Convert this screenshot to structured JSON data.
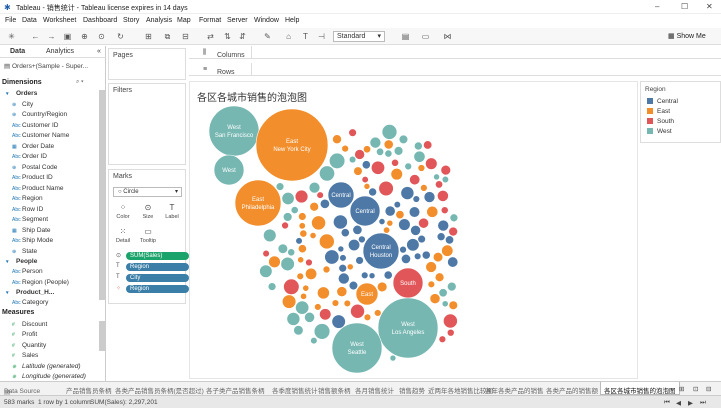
{
  "window": {
    "title": "Tableau - 销售统计 - Tableau license expires in 14 days"
  },
  "menu": [
    "File",
    "Data",
    "Worksheet",
    "Dashboard",
    "Story",
    "Analysis",
    "Map",
    "Format",
    "Server",
    "Window",
    "Help"
  ],
  "toolbar": {
    "fit_mode": "Standard",
    "show_me": "Show Me"
  },
  "data_pane": {
    "tabs": [
      "Data",
      "Analytics"
    ],
    "datasource": "Orders+(Sample - Super...",
    "dimensions_header": "Dimensions",
    "groups": [
      {
        "name": "Orders",
        "fields": [
          "City",
          "Country/Region",
          "Customer ID",
          "Customer Name",
          "Order Date",
          "Order ID",
          "Postal Code",
          "Product ID",
          "Product Name",
          "Region",
          "Row ID",
          "Segment",
          "Ship Date",
          "Ship Mode",
          "State"
        ]
      },
      {
        "name": "People",
        "fields": [
          "Person",
          "Region (People)"
        ]
      },
      {
        "name": "Product_H...",
        "fields": [
          "Category"
        ]
      }
    ],
    "measures_header": "Measures",
    "measures": [
      "Discount",
      "Profit",
      "Quantity",
      "Sales",
      "Latitude (generated)",
      "Longitude (generated)"
    ]
  },
  "cards": {
    "pages": "Pages",
    "filters": "Filters",
    "marks": "Marks",
    "mark_type": "Circle",
    "mark_buttons": [
      "Color",
      "Size",
      "Label",
      "Detail",
      "Tooltip"
    ],
    "pills": [
      "SUM(Sales)",
      "Region",
      "City",
      "Region"
    ]
  },
  "shelves": {
    "columns": "Columns",
    "rows": "Rows"
  },
  "view": {
    "title": "各区各城市销售的泡泡图"
  },
  "legend": {
    "title": "Region",
    "items": [
      {
        "label": "Central",
        "color": "#4e79a7"
      },
      {
        "label": "East",
        "color": "#f28e2b"
      },
      {
        "label": "South",
        "color": "#e15759"
      },
      {
        "label": "West",
        "color": "#76b7b2"
      }
    ]
  },
  "labeled_bubbles": [
    {
      "region": "West",
      "city": "San Francisco"
    },
    {
      "region": "East",
      "city": "New York City"
    },
    {
      "region": "West",
      "city": ""
    },
    {
      "region": "East",
      "city": "Philadelphia"
    },
    {
      "region": "Central",
      "city": ""
    },
    {
      "region": "Central",
      "city": ""
    },
    {
      "region": "Central",
      "city": "Houston"
    },
    {
      "region": "South",
      "city": ""
    },
    {
      "region": "East",
      "city": ""
    },
    {
      "region": "West",
      "city": "Los Angeles"
    },
    {
      "region": "West",
      "city": "Seattle"
    }
  ],
  "sheet_tabs": [
    "Data Source",
    "产品销售员条柄",
    "各类产品销售员条柄(是否超过)",
    "各子类产品销售条柄",
    "各季度销售统计",
    "销售额条柄",
    "各月销售统计",
    "销售趋势",
    "近两年各地销售比较图",
    "各年各类产品的销售",
    "各类产品的销售额",
    "各区各城市销售的泡泡图"
  ],
  "active_tab": "各区各城市销售的泡泡图",
  "status": {
    "marks": "583 marks",
    "rows_cols": "1 row by 1 column",
    "sum": "SUM(Sales): 2,297,201"
  }
}
